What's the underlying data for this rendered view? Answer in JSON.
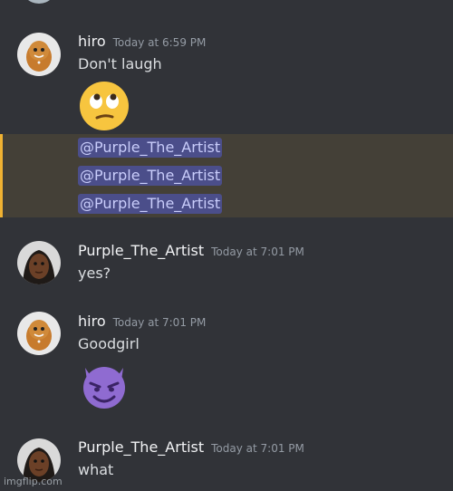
{
  "colors": {
    "background": "#313338",
    "highlight": "#444037",
    "highlight_bar": "#f0b232",
    "mention_bg": "#4b4e8a",
    "mention_text": "#c9cdfb"
  },
  "messages": [
    {
      "username": "hiro",
      "timestamp": "Today at 6:59 PM",
      "text": "Don't laugh",
      "emoji": "face-with-rolling-eyes"
    },
    {
      "mentions": [
        "@Purple_The_Artist",
        "@Purple_The_Artist",
        "@Purple_The_Artist"
      ]
    },
    {
      "username": "Purple_The_Artist",
      "timestamp": "Today at 7:01 PM",
      "text": "yes?"
    },
    {
      "username": "hiro",
      "timestamp": "Today at 7:01 PM",
      "text": "Goodgirl",
      "emoji": "smiling-face-with-horns"
    },
    {
      "username": "Purple_The_Artist",
      "timestamp": "Today at 7:01 PM",
      "text": "what"
    }
  ],
  "watermark": "imgflip.com"
}
